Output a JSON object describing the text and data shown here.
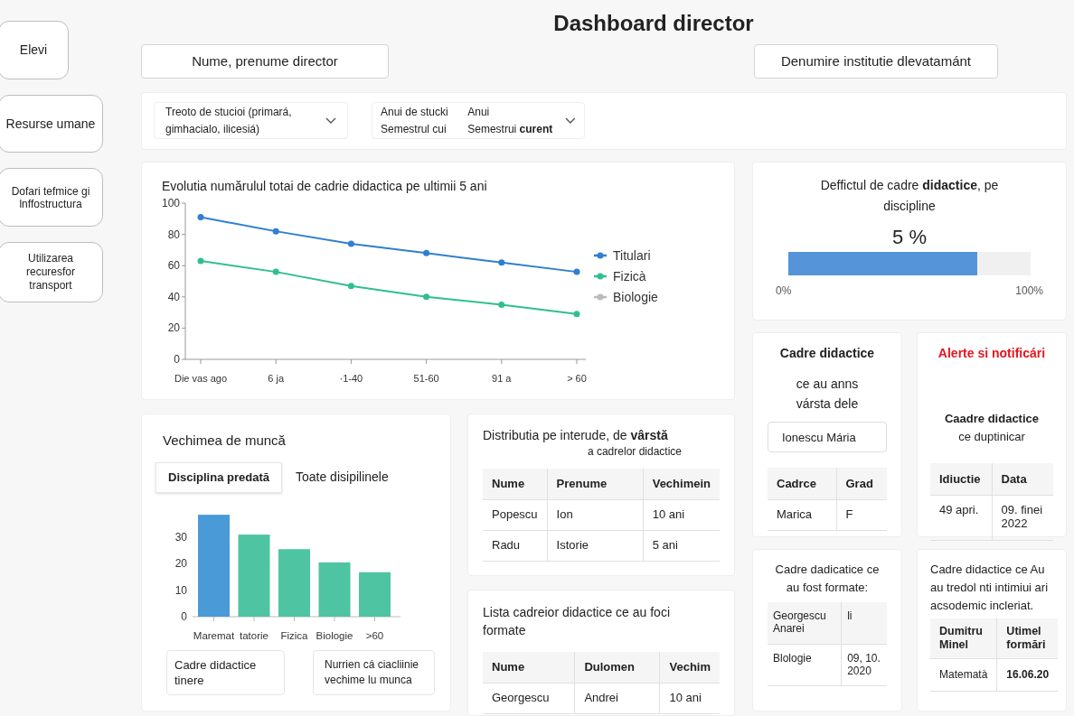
{
  "sidebar": {
    "items": [
      {
        "label": "Elevi"
      },
      {
        "label": "Resurse umane"
      },
      {
        "label": "Dofari tefmice gi lnffostructura"
      },
      {
        "label": "Utilizarea recuresfor transport"
      }
    ]
  },
  "title": "Dashboard director",
  "header": {
    "director": "Nume, prenume director",
    "institution": "Denumire institutie dlevatamánt"
  },
  "filters": [
    {
      "kind": "single",
      "text": "Treoto de stucioi (primará, gimhacialo, ilicesiá)"
    },
    {
      "kind": "double",
      "label_lines": [
        "Anui de stucki",
        "Semestrul cui"
      ],
      "value_lines": [
        "Anui",
        "Semestrui **curent**"
      ]
    }
  ],
  "evolution": {
    "chart_data": {
      "type": "line",
      "title": "Evolutia numărulul totai de cadrie didactica pe ultimii 5 ani",
      "categories": [
        "Die vas ago",
        "6 ja",
        "·1-40",
        "51-60",
        "91 a",
        "> 60"
      ],
      "ylim": [
        0,
        100
      ],
      "yticks": [
        0,
        20,
        40,
        60,
        80,
        100
      ],
      "legend": true,
      "series": [
        {
          "name": "Titulari",
          "color": "#2f7fd0",
          "marker": "circle",
          "values": [
            91,
            82,
            74,
            68,
            62,
            56
          ]
        },
        {
          "name": "Fizicà",
          "color": "#2fbf8f",
          "marker": "circle",
          "values": [
            63,
            56,
            47,
            40,
            35,
            29
          ]
        },
        {
          "name": "Biologie",
          "color": "#bbbbbb",
          "marker": "circle",
          "values": [
            null,
            null,
            null,
            null,
            null,
            null
          ]
        }
      ]
    }
  },
  "deficit": {
    "title": "Deffictul de cadre **didactice**, pe discipline",
    "value": "5 %",
    "level": 0.78,
    "min_label": "0%",
    "max_label": "100%"
  },
  "seniority": {
    "title": "Vechimea de muncă",
    "tabs": [
      {
        "label": "Disciplina predată",
        "selected": true
      },
      {
        "label": "Toate disipilinele",
        "selected": false
      }
    ],
    "chart_data": {
      "type": "bar",
      "categories": [
        "Maremat",
        "tatorie",
        "Fizica",
        "Biologie",
        ">60"
      ],
      "yticks": [
        0,
        10,
        20,
        30
      ],
      "ylim": [
        0,
        40
      ],
      "stacked": true,
      "series": [
        {
          "color": "#4a9ad8",
          "values": [
            38.5,
            null,
            null,
            null,
            null
          ]
        },
        {
          "color": "#4fc4a2",
          "values": [
            null,
            31,
            25.5,
            20.5,
            16.8
          ]
        }
      ]
    },
    "boxes": [
      {
        "kind": "bold",
        "text": "Cadre didactice tinere"
      },
      {
        "kind": "plain",
        "text": "Nurrien cá ciacliinie vechime lu munca"
      }
    ]
  },
  "distribution": {
    "title": "Distributia pe interude, de **vârstă**",
    "subtitle": "a cadrelor didactice",
    "columns": [
      "Nume",
      "Prenume",
      "Vechimein"
    ],
    "rows": [
      [
        "Popescu",
        "Ion",
        "10 ani"
      ],
      [
        "Radu",
        "Istorie",
        "5 ani"
      ]
    ]
  },
  "trained_list": {
    "title": "Lista cadreior didactice ce au foci formate",
    "columns": [
      "Nume",
      "Dulomen",
      "Vechim"
    ],
    "rows": [
      [
        "Georgescu",
        "Andrei",
        "10 ani"
      ]
    ]
  },
  "age_card": {
    "title": "Cadre didactice",
    "subtitle": "ce au anns vársta dele",
    "search_value": "Ionescu Mária",
    "columns": [
      "Cadrce",
      "Grad"
    ],
    "rows": [
      [
        "Marica",
        "F"
      ]
    ]
  },
  "alerts": {
    "title": "Alerte si notificári",
    "subtitle_bold": "Caadre didactice",
    "subtitle": "ce duptinicar",
    "columns": [
      "Idiuctie",
      "Data"
    ],
    "rows": [
      [
        "49 apri.",
        "09. finei 2022"
      ]
    ]
  },
  "formed_card": {
    "title": "Cadre dadicatice ce au fost formate:",
    "rows": [
      [
        "Georgescu Anarei",
        "li"
      ],
      [
        "Blologie",
        "09, 10. 2020"
      ]
    ]
  },
  "academic_card": {
    "title": "Cadre didactice ce Au au tredol nti intimiui ari acsodemic incleriat.",
    "columns": [
      "Dumitru Minel",
      "Utimel formări"
    ],
    "rows": [
      [
        "Matematà",
        "16.06.20"
      ]
    ]
  }
}
